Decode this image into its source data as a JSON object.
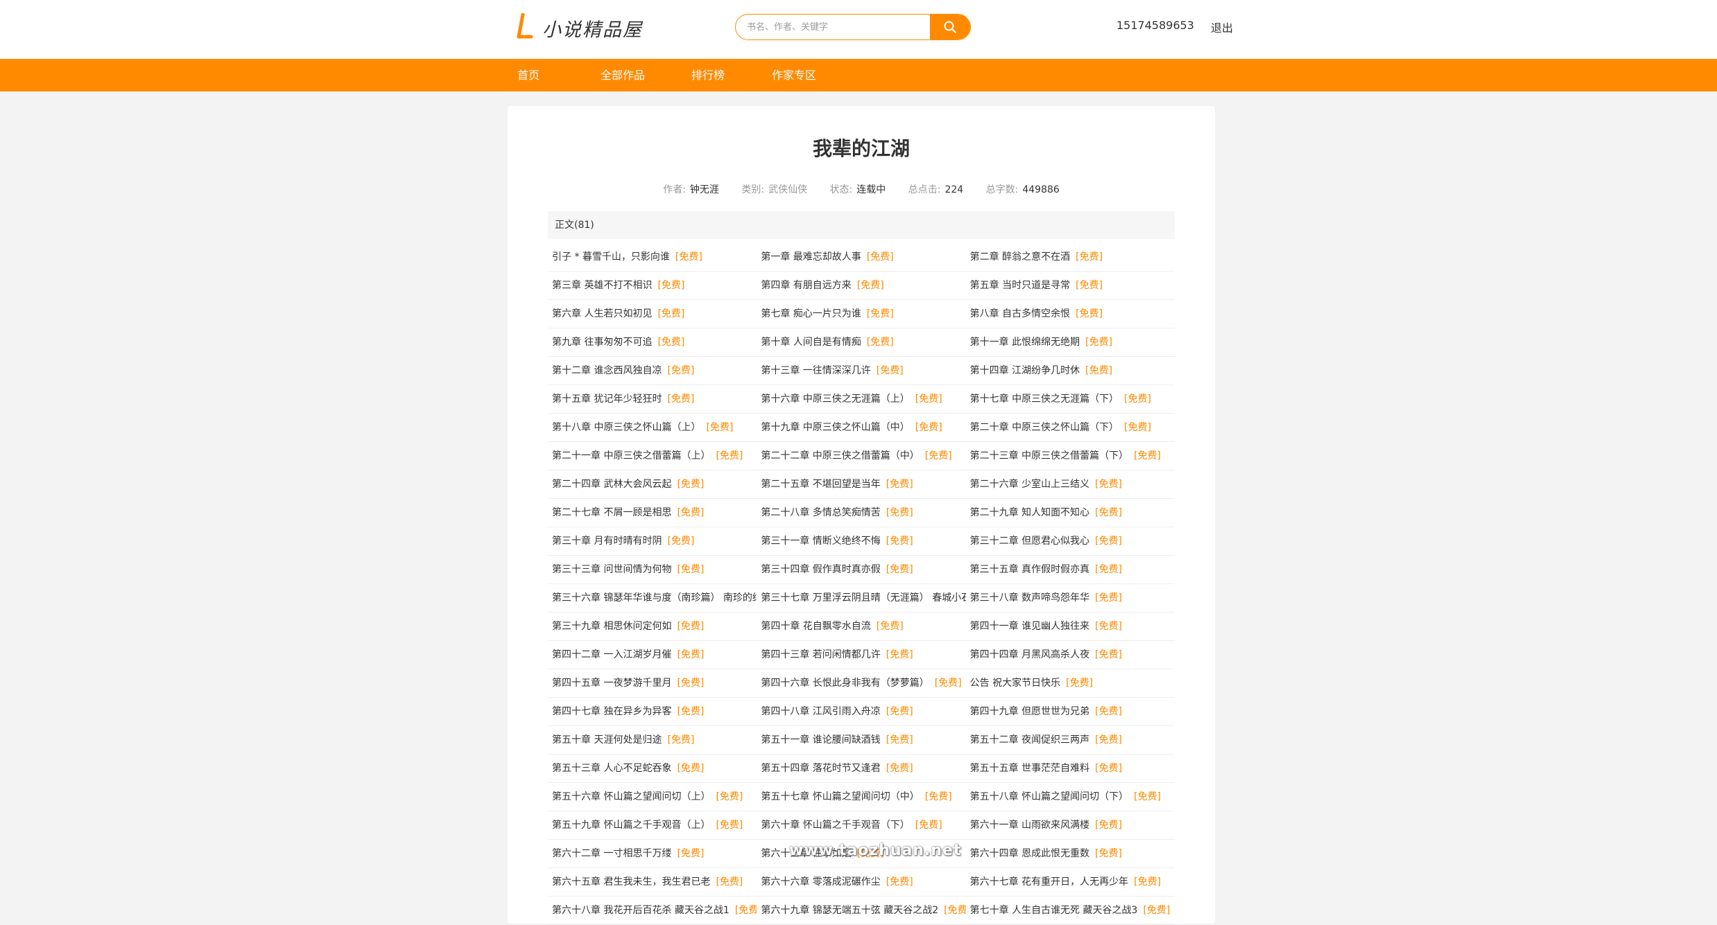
{
  "header": {
    "logo_text": "小说精品屋",
    "search_placeholder": "书名、作者、关键字",
    "user_phone": "15174589653",
    "logout": "退出"
  },
  "nav": [
    "首页",
    "全部作品",
    "排行榜",
    "作家专区"
  ],
  "book": {
    "title": "我辈的江湖",
    "author_label": "作者:",
    "author": "钟无涯",
    "category_label": "类别:",
    "category": "武侠仙侠",
    "status_label": "状态:",
    "status": "连载中",
    "clicks_label": "总点击:",
    "clicks": "224",
    "words_label": "总字数:",
    "words": "449886"
  },
  "section_head": "正文(81)",
  "free_tag": "[免费]",
  "chapters": [
    [
      "引子 * 暮雪千山，只影向谁",
      "第一章 最难忘却故人事",
      "第二章 醉翁之意不在酒"
    ],
    [
      "第三章 英雄不打不相识",
      "第四章 有朋自远方来",
      "第五章 当时只道是寻常"
    ],
    [
      "第六章 人生若只如初见",
      "第七章 痴心一片只为谁",
      "第八章 自古多情空余恨"
    ],
    [
      "第九章 往事匆匆不可追",
      "第十章 人间自是有情痴",
      "第十一章 此恨绵绵无绝期"
    ],
    [
      "第十二章 谁念西风独自凉",
      "第十三章 一往情深深几许",
      "第十四章 江湖纷争几时休"
    ],
    [
      "第十五章 犹记年少轻狂时",
      "第十六章 中原三侠之无涯篇（上）",
      "第十七章 中原三侠之无涯篇（下）"
    ],
    [
      "第十八章 中原三侠之怀山篇（上）",
      "第十九章 中原三侠之怀山篇（中）",
      "第二十章 中原三侠之怀山篇（下）"
    ],
    [
      "第二十一章 中原三侠之借蕾篇（上）",
      "第二十二章 中原三侠之借蕾篇（中）",
      "第二十三章 中原三侠之借蕾篇（下）"
    ],
    [
      "第二十四章 武林大会风云起",
      "第二十五章 不堪回望是当年",
      "第二十六章 少室山上三结义"
    ],
    [
      "第二十七章 不屑一顾是相思",
      "第二十八章 多情总笑痴情苦",
      "第二十九章 知人知面不知心"
    ],
    [
      "第三十章 月有时晴有时阴",
      "第三十一章 情断义绝终不悔",
      "第三十二章 但愿君心似我心"
    ],
    [
      "第三十三章 问世间情为何物",
      "第三十四章 假作真时真亦假",
      "第三十五章 真作假时假亦真"
    ],
    [
      "第三十六章 锦瑟年华谁与度（南珍篇） 南珍的结局",
      "第三十七章 万里浮云阴且晴（无涯篇） 春城小石",
      "第三十八章 数声啼鸟怨年华"
    ],
    [
      "第三十九章 相思休问定何如",
      "第四十章 花自飘零水自流",
      "第四十一章 谁见幽人独往来"
    ],
    [
      "第四十二章 一入江湖岁月催",
      "第四十三章 若问闲情都几许",
      "第四十四章 月黑风高杀人夜"
    ],
    [
      "第四十五章 一夜梦游千里月",
      "第四十六章 长恨此身非我有（梦萝篇）",
      "公告 祝大家节日快乐"
    ],
    [
      "第四十七章 独在异乡为异客",
      "第四十八章 江风引雨入舟凉",
      "第四十九章 但愿世世为兄弟"
    ],
    [
      "第五十章 天涯何处是归途",
      "第五十一章 谁论腰间缺酒钱",
      "第五十二章 夜闻促织三两声"
    ],
    [
      "第五十三章 人心不足蛇吞象",
      "第五十四章 落花时节又逢君",
      "第五十五章 世事茫茫自难料"
    ],
    [
      "第五十六章 怀山篇之望闻问切（上）",
      "第五十七章 怀山篇之望闻问切（中）",
      "第五十八章 怀山篇之望闻问切（下）"
    ],
    [
      "第五十九章 怀山篇之千手观音（上）",
      "第六十章 怀山篇之千手观音（下）",
      "第六十一章 山雨欲来风满楼"
    ],
    [
      "第六十二章 一寸相思千万缕",
      "第六十三章 往事如烟",
      "第六十四章 恩成此恨无重数"
    ],
    [
      "第六十五章 君生我未生，我生君已老",
      "第六十六章 零落成泥碾作尘",
      "第六十七章 花有重开日，人无再少年"
    ],
    [
      "第六十八章 我花开后百花杀 藏天谷之战1",
      "第六十九章 锦瑟无端五十弦 藏天谷之战2",
      "第七十章 人生自古谁无死 藏天谷之战3"
    ]
  ],
  "watermark": "www.taozhuan.net",
  "colors": {
    "accent": "#ff8a00",
    "page_bg": "#f3f3f3"
  }
}
